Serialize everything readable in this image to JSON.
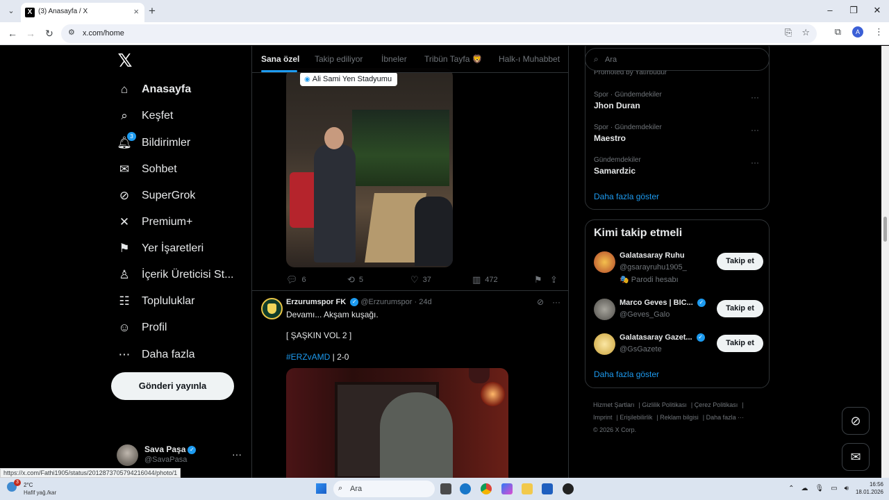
{
  "browser": {
    "tab_title": "(3) Anasayfa / X",
    "tab_favicon": "X",
    "new_tab_icon": "+",
    "close_tab_icon": "×",
    "url": "x.com/home",
    "profile_initial": "A",
    "window_controls": [
      "–",
      "❐",
      "✕"
    ]
  },
  "sidebar": {
    "logo": "𝕏",
    "items": [
      {
        "label": "Anasayfa",
        "icon": "⌂",
        "icon_name": "home-icon"
      },
      {
        "label": "Keşfet",
        "icon": "⌕",
        "icon_name": "search-icon"
      },
      {
        "label": "Bildirimler",
        "icon": "♫",
        "icon_name": "bell-icon",
        "badge": "3"
      },
      {
        "label": "Sohbet",
        "icon": "✉",
        "icon_name": "mail-icon"
      },
      {
        "label": "SuperGrok",
        "icon": "⊘",
        "icon_name": "grok-icon"
      },
      {
        "label": "Premium+",
        "icon": "✕",
        "icon_name": "x-premium-icon"
      },
      {
        "label": "Yer İşaretleri",
        "icon": "⚑",
        "icon_name": "bookmark-icon"
      },
      {
        "label": "İçerik Üreticisi St...",
        "icon": "♙",
        "icon_name": "creator-studio-icon"
      },
      {
        "label": "Topluluklar",
        "icon": "☷",
        "icon_name": "communities-icon"
      },
      {
        "label": "Profil",
        "icon": "☺",
        "icon_name": "profile-icon"
      },
      {
        "label": "Daha fazla",
        "icon": "⋯",
        "icon_name": "more-icon"
      }
    ],
    "post_button": "Gönderi yayınla",
    "user": {
      "name": "Sava Paşa",
      "handle": "@SavaPasa",
      "more": "···"
    }
  },
  "main": {
    "tabs": [
      "Sana özel",
      "Takip ediliyor",
      "İbneler",
      "Tribün Tayfa 🦁",
      "Halk-ı Muhabbet"
    ],
    "tweet1": {
      "location_tag": "Ali Sami Yen Stadyumu",
      "replies": "6",
      "retweets": "5",
      "likes": "37",
      "views": "472"
    },
    "tweet2": {
      "name": "Erzurumspor FK",
      "handle": "@Erzurumspor",
      "time": "· 24d",
      "line1": "Devamı... Akşam kuşağı.",
      "line2": "[ ŞAŞKIN VOL 2 ]",
      "hashtag": "#ERZvAMD",
      "score": " | 2-0"
    }
  },
  "right": {
    "search_placeholder": "Ara",
    "promoted_text": "Promoted by Yatırbudur",
    "trends": [
      {
        "category": "Spor · Gündemdekiler",
        "name": "Jhon Duran"
      },
      {
        "category": "Spor · Gündemdekiler",
        "name": "Maestro"
      },
      {
        "category": "Gündemdekiler",
        "name": "Samardzic"
      }
    ],
    "trends_more": "Daha fazla göster",
    "who_to_follow_title": "Kimi takip etmeli",
    "who_to_follow": [
      {
        "name": "Galatasaray Ruhu",
        "handle": "@gsarayruhu1905_",
        "extra": "🎭 Parodi hesabı",
        "verified": false,
        "color": "#e2a43a"
      },
      {
        "name": "Marco Geves | BIC...",
        "handle": "@Geves_Galo",
        "extra": "",
        "verified": true,
        "color": "#7c7c74"
      },
      {
        "name": "Galatasaray Gazet...",
        "handle": "@GsGazete",
        "extra": "",
        "verified": true,
        "color": "#f2c94c"
      }
    ],
    "follow_label": "Takip et",
    "who_more": "Daha fazla göster",
    "footer": [
      "Hizmet Şartları",
      "Gizlilik Politikası",
      "Çerez Politikası",
      "Imprint",
      "Erişilebilirlik",
      "Reklam bilgisi",
      "Daha fazla ···",
      "© 2026 X Corp."
    ]
  },
  "status_url": "https://x.com/Fathi1905/status/2012873705794216044/photo/1",
  "taskbar": {
    "weather_temp": "2°C",
    "weather_desc": "Hafif yağ./kar",
    "weather_badge": "3",
    "search_label": "Ara",
    "time": "16:56",
    "date": "18.01.2026"
  },
  "colors": {
    "accent": "#1d9bf0",
    "background": "#000000",
    "muted": "#71767b"
  }
}
